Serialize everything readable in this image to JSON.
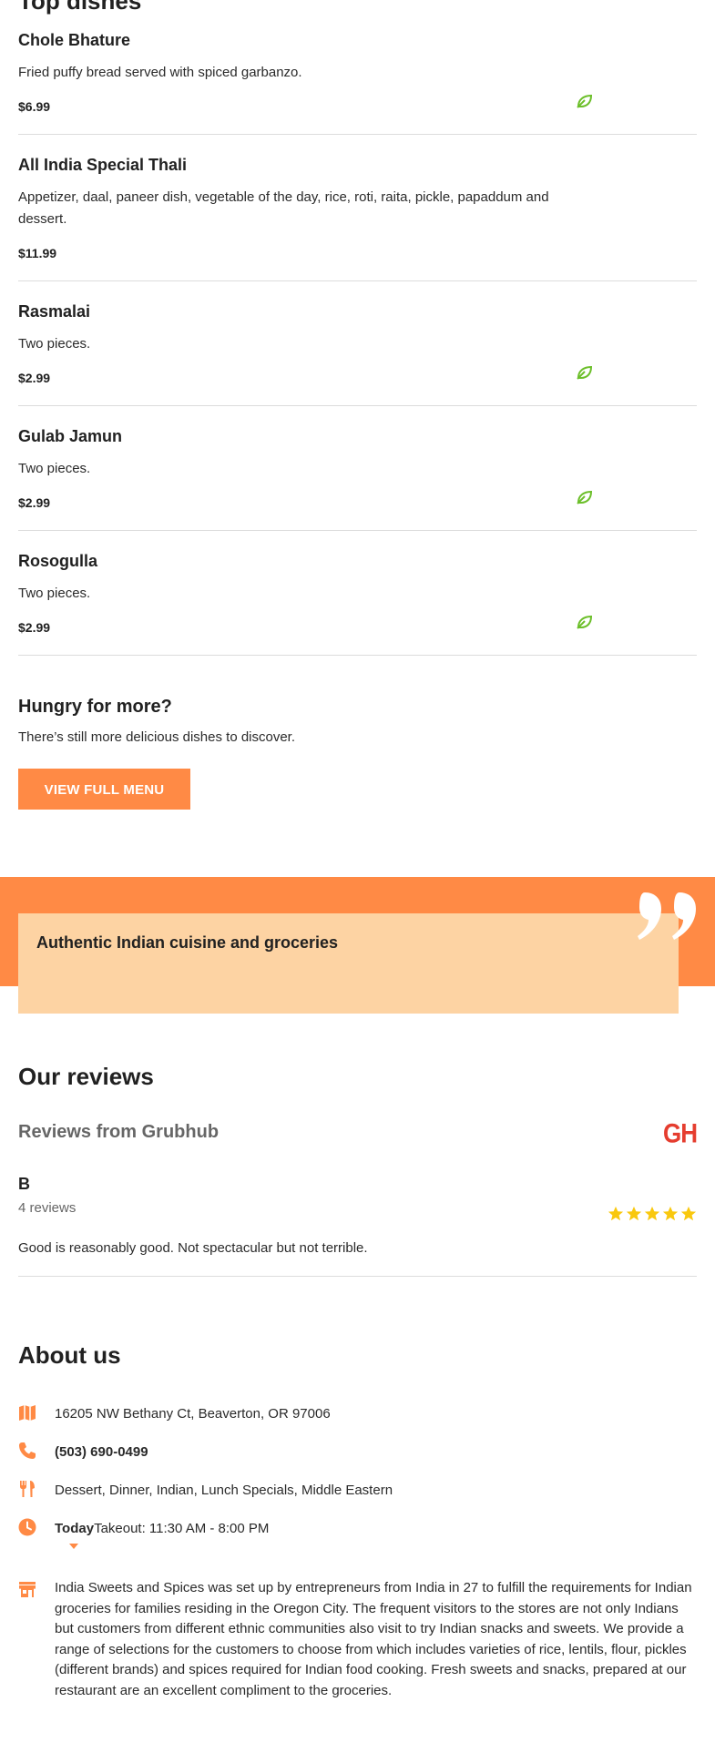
{
  "top_dishes": {
    "title": "Top dishes",
    "items": [
      {
        "name": "Chole Bhature",
        "description": "Fried puffy bread served with spiced garbanzo.",
        "price": "$6.99",
        "veg": true
      },
      {
        "name": "All India Special Thali",
        "description": "Appetizer, daal, paneer dish, vegetable of the day, rice, roti, raita, pickle, papaddum and dessert.",
        "price": "$11.99",
        "veg": false
      },
      {
        "name": "Rasmalai",
        "description": "Two pieces.",
        "price": "$2.99",
        "veg": true
      },
      {
        "name": "Gulab Jamun",
        "description": "Two pieces.",
        "price": "$2.99",
        "veg": true
      },
      {
        "name": "Rosogulla",
        "description": "Two pieces.",
        "price": "$2.99",
        "veg": true
      }
    ]
  },
  "more": {
    "title": "Hungry for more?",
    "text": "There’s still more delicious dishes to discover.",
    "button": "VIEW FULL MENU"
  },
  "quote": {
    "text": "Authentic Indian cuisine and groceries"
  },
  "reviews": {
    "title": "Our reviews",
    "source": "Reviews from Grubhub",
    "logo": "GH",
    "items": [
      {
        "name": "B",
        "count": "4 reviews",
        "rating": 5,
        "text": "Good is reasonably good. Not spectacular but not terrible."
      }
    ]
  },
  "about": {
    "title": "About us",
    "address": "16205 NW Bethany Ct, Beaverton, OR 97006",
    "phone": "(503) 690-0499",
    "cuisines": "Dessert, Dinner, Indian, Lunch Specials, Middle Eastern",
    "hours_day": "Today",
    "hours_text": "Takeout: 11:30 AM - 8:00 PM",
    "description": "India Sweets and Spices was set up by entrepreneurs from India in 27 to fulfill the requirements for Indian groceries for families residing in the Oregon City. The frequent visitors to the stores are not only Indians but customers from different ethnic communities also visit to try Indian snacks and sweets. We provide a range of selections for the customers to choose from which includes varieties of rice, lentils, flour, pickles (different brands) and spices required for Indian food cooking. Fresh sweets and snacks, prepared at our restaurant are an excellent compliment to the groceries."
  },
  "colors": {
    "accent": "#ff8a45",
    "veg": "#6cbf2a",
    "star": "#f9c80e",
    "grubhub": "#e53d2f"
  },
  "icons": [
    "leaf-icon",
    "quote-icon",
    "star-icon",
    "map-icon",
    "phone-icon",
    "utensils-icon",
    "clock-icon",
    "caret-down-icon",
    "store-icon"
  ]
}
